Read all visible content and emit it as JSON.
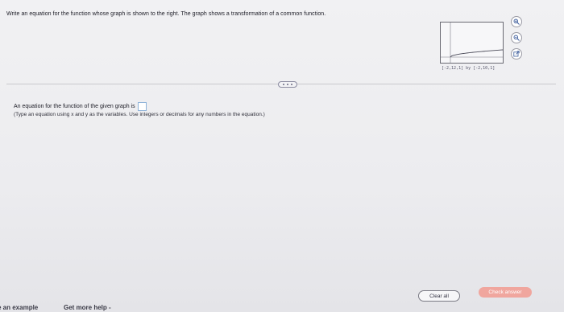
{
  "question": {
    "prompt": "Write an equation for the function whose graph is shown to the right. The graph shows a transformation of a common function."
  },
  "graph": {
    "window_text": "[-2,12,1] by [-2,10,1]",
    "curve_type": "square-root transformation"
  },
  "tools": {
    "zoom_in_icon": "magnifier-plus-icon",
    "zoom_out_icon": "magnifier-minus-icon",
    "popout_icon": "external-link-icon"
  },
  "answer": {
    "label": "An equation for the function of the given graph is",
    "instructions": "(Type an equation using x and y as the variables. Use integers or decimals for any numbers in the equation.)"
  },
  "footer": {
    "example_label": "e an example",
    "help_label": "Get more help -",
    "clear_label": "Clear all",
    "check_label": "Check answer"
  },
  "colors": {
    "background": "#ececef",
    "check_button": "#f0a69e",
    "answer_box_border": "#8fb3d9"
  }
}
